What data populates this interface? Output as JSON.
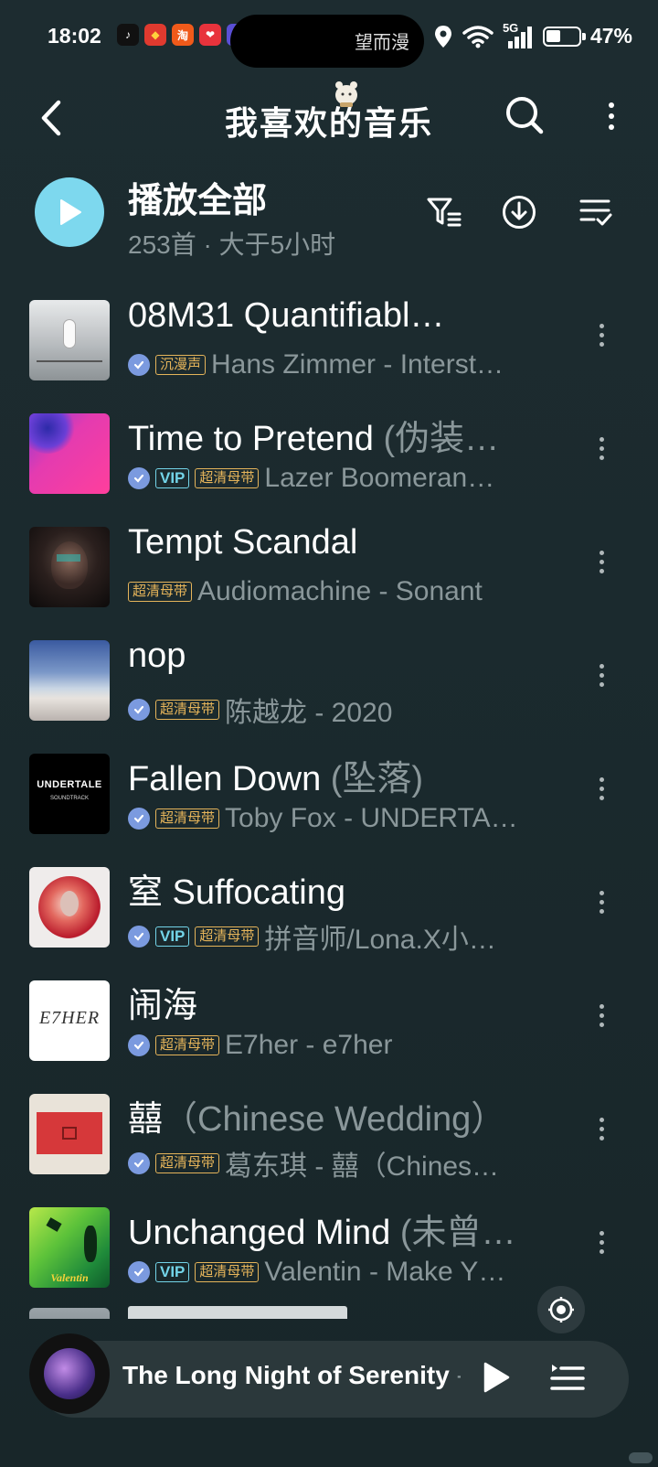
{
  "status_bar": {
    "time": "18:02",
    "island_text": "望而漫",
    "network": "5G",
    "battery": "47%"
  },
  "header": {
    "title": "我喜欢的音乐",
    "back_icon": "chevron-left-icon",
    "search_icon": "search-icon",
    "more_icon": "more-vertical-icon"
  },
  "play_all": {
    "label": "播放全部",
    "count": "253首 · 大于5小时"
  },
  "colors": {
    "accent": "#7dd8ee",
    "vip": "#73d4e8",
    "hq": "#e5b45a",
    "secondary_text": "#8a979a",
    "background": "#1b2a2e"
  },
  "songs": [
    {
      "title": "08M31 Quantifiabl…",
      "title_sub": "",
      "verified": true,
      "badges": [
        "沉漫声"
      ],
      "artist": "Hans Zimmer - Interst…"
    },
    {
      "title": "Time to Pretend",
      "title_sub": " (伪装…",
      "verified": true,
      "badges": [
        "VIP",
        "超清母带"
      ],
      "artist": "Lazer Boomeran…"
    },
    {
      "title": "Tempt Scandal",
      "title_sub": "",
      "verified": false,
      "badges": [
        "超清母带"
      ],
      "artist": "Audiomachine - Sonant"
    },
    {
      "title": "nop",
      "title_sub": "",
      "verified": true,
      "badges": [
        "超清母带"
      ],
      "artist": "陈越龙 - 2020"
    },
    {
      "title": "Fallen Down",
      "title_sub": " (坠落)",
      "verified": true,
      "badges": [
        "超清母带"
      ],
      "artist": "Toby Fox - UNDERTA…"
    },
    {
      "title": "窒 Suffocating",
      "title_sub": "",
      "verified": true,
      "badges": [
        "VIP",
        "超清母带"
      ],
      "artist": "拼音师/Lona.X小…"
    },
    {
      "title": "闹海",
      "title_sub": "",
      "verified": true,
      "badges": [
        "超清母带"
      ],
      "artist": "E7her - e7her"
    },
    {
      "title": "囍",
      "title_sub": "（Chinese Wedding）",
      "verified": true,
      "badges": [
        "超清母带"
      ],
      "artist": "葛东琪 - 囍（Chines…"
    },
    {
      "title": "Unchanged Mind",
      "title_sub": " (未曾…",
      "verified": true,
      "badges": [
        "VIP",
        "超清母带"
      ],
      "artist": "Valentin - Make Y…"
    }
  ],
  "cover_texts": {
    "undertale": "UNDERTALE",
    "undertale_sub": "SOUNDTRACK",
    "e7her": "E7HER",
    "valentin": "Valentin"
  },
  "mini_player": {
    "title": "The Long Night of Serenity",
    "title_sub": " - H"
  }
}
